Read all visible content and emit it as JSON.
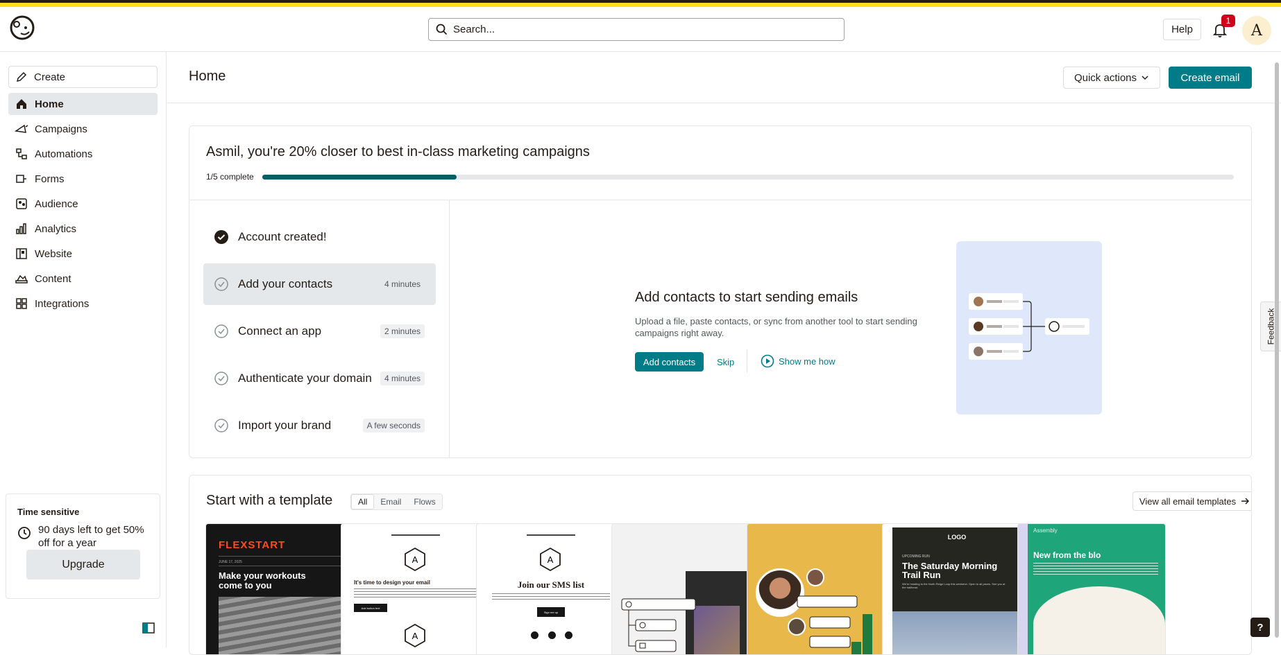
{
  "search": {
    "placeholder": "Search..."
  },
  "header": {
    "help_label": "Help",
    "notification_count": "1",
    "avatar_initial": "A"
  },
  "sidebar": {
    "create_label": "Create",
    "items": [
      {
        "label": "Home",
        "icon": "home-icon",
        "active": true
      },
      {
        "label": "Campaigns",
        "icon": "megaphone-icon"
      },
      {
        "label": "Automations",
        "icon": "automation-icon"
      },
      {
        "label": "Forms",
        "icon": "form-icon"
      },
      {
        "label": "Audience",
        "icon": "audience-icon"
      },
      {
        "label": "Analytics",
        "icon": "analytics-icon"
      },
      {
        "label": "Website",
        "icon": "website-icon"
      },
      {
        "label": "Content",
        "icon": "content-icon"
      },
      {
        "label": "Integrations",
        "icon": "integrations-icon"
      }
    ],
    "time_sensitive": {
      "title": "Time sensitive",
      "message": "90 days left to get 50% off for a year",
      "upgrade_label": "Upgrade"
    }
  },
  "page": {
    "title": "Home",
    "quick_actions_label": "Quick actions",
    "create_email_label": "Create email"
  },
  "onboarding": {
    "title": "Asmil, you're 20% closer to best in-class marketing campaigns",
    "progress_label": "1/5 complete",
    "progress_fraction": 0.2,
    "steps": [
      {
        "label": "Account created!",
        "duration": "",
        "done": true
      },
      {
        "label": "Add your contacts",
        "duration": "4 minutes",
        "active": true
      },
      {
        "label": "Connect an app",
        "duration": "2 minutes"
      },
      {
        "label": "Authenticate your domain",
        "duration": "4 minutes"
      },
      {
        "label": "Import your brand",
        "duration": "A few seconds"
      }
    ],
    "detail": {
      "title": "Add contacts to start sending emails",
      "description": "Upload a file, paste contacts, or sync from another tool to start sending campaigns right away.",
      "primary_label": "Add contacts",
      "skip_label": "Skip",
      "show_me_label": "Show me how"
    }
  },
  "templates": {
    "title": "Start with a template",
    "tabs": [
      "All",
      "Email",
      "Flows"
    ],
    "active_tab": "All",
    "view_all_label": "View all email templates",
    "cards": [
      {
        "brand": "FLEXSTART",
        "headline": "Make your workouts come to you",
        "date": "JUNE 17, 2025"
      },
      {
        "headline": "It's time to design your email",
        "button": "Add button text"
      },
      {
        "headline": "Join our SMS list",
        "button": "Sign me up"
      },
      {
        "headline": ""
      },
      {
        "headline": ""
      },
      {
        "brand": "LOGO",
        "kicker": "UPCOMING RUN",
        "headline": "The Saturday Morning Trail Run",
        "body": "We're heading to the North Ridge Loop this weekend. Open to all paces. See you at the trailhead."
      },
      {
        "brand": "Assembly",
        "headline": "New from the blo"
      }
    ]
  },
  "feedback_label": "Feedback",
  "help_fab_label": "?",
  "colors": {
    "accent": "#007c89",
    "brand_yellow": "#ffe01b",
    "progress": "#005f66",
    "nav_active": "#e4e8eb"
  }
}
